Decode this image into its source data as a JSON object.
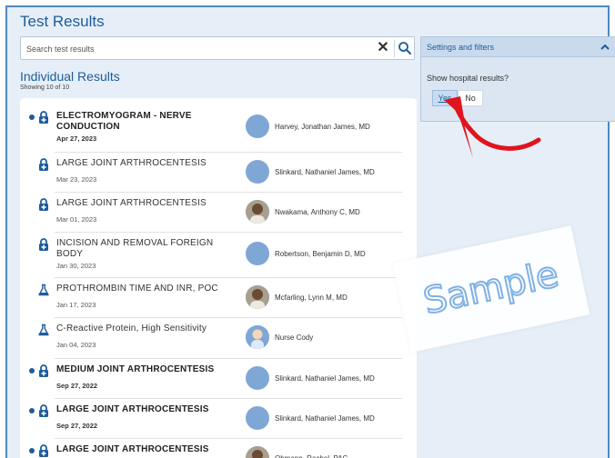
{
  "header": {
    "title": "Test Results"
  },
  "search": {
    "placeholder": "Search test results",
    "value": ""
  },
  "results": {
    "heading": "Individual Results",
    "count": "Showing 10 of 10",
    "items": [
      {
        "name_line1": "ELECTROMYOGRAM - NERVE",
        "name_line2": "CONDUCTION",
        "date": "Apr 27, 2023",
        "provider": "Harvey, Jonathan James, MD",
        "unread": true,
        "icon": "hospital-lock-icon",
        "avatar": "generic"
      },
      {
        "name_line1": "LARGE JOINT ARTHROCENTESIS",
        "name_line2": "",
        "date": "Mar 23, 2023",
        "provider": "Slinkard, Nathaniel James, MD",
        "unread": false,
        "icon": "hospital-lock-icon",
        "avatar": "generic"
      },
      {
        "name_line1": "LARGE JOINT ARTHROCENTESIS",
        "name_line2": "",
        "date": "Mar 01, 2023",
        "provider": "Nwakama, Anthony C, MD",
        "unread": false,
        "icon": "hospital-lock-icon",
        "avatar": "photo"
      },
      {
        "name_line1": "INCISION AND REMOVAL FOREIGN",
        "name_line2": "BODY",
        "date": "Jan 30, 2023",
        "provider": "Robertson, Benjamin D, MD",
        "unread": false,
        "icon": "hospital-lock-icon",
        "avatar": "generic"
      },
      {
        "name_line1": "PROTHROMBIN TIME AND INR, POC",
        "name_line2": "",
        "date": "Jan 17, 2023",
        "provider": "Mcfarling, Lynn M, MD",
        "unread": false,
        "icon": "flask-icon",
        "avatar": "photo"
      },
      {
        "name_line1": "C-Reactive Protein, High Sensitivity",
        "name_line2": "",
        "date": "Jan 04, 2023",
        "provider": "Nurse Cody",
        "unread": false,
        "icon": "flask-icon",
        "avatar": "nurse"
      },
      {
        "name_line1": "MEDIUM JOINT ARTHROCENTESIS",
        "name_line2": "",
        "date": "Sep 27, 2022",
        "provider": "Slinkard, Nathaniel James, MD",
        "unread": true,
        "icon": "hospital-lock-icon",
        "avatar": "generic"
      },
      {
        "name_line1": "LARGE JOINT ARTHROCENTESIS",
        "name_line2": "",
        "date": "Sep 27, 2022",
        "provider": "Slinkard, Nathaniel James, MD",
        "unread": true,
        "icon": "hospital-lock-icon",
        "avatar": "generic"
      },
      {
        "name_line1": "LARGE JOINT ARTHROCENTESIS",
        "name_line2": "",
        "date": "",
        "provider": "Ohmann, Rachel, PAC",
        "unread": true,
        "icon": "hospital-lock-icon",
        "avatar": "photo"
      }
    ]
  },
  "settings": {
    "title": "Settings and filters",
    "question": "Show hospital results?",
    "yes_label": "Yes",
    "no_label": "No",
    "selected": "Yes"
  },
  "watermark": {
    "text": "Sample"
  },
  "colors": {
    "accent": "#1d5c9c",
    "panel_bg": "#e6eef7",
    "annotation_arrow": "#e0141e"
  }
}
